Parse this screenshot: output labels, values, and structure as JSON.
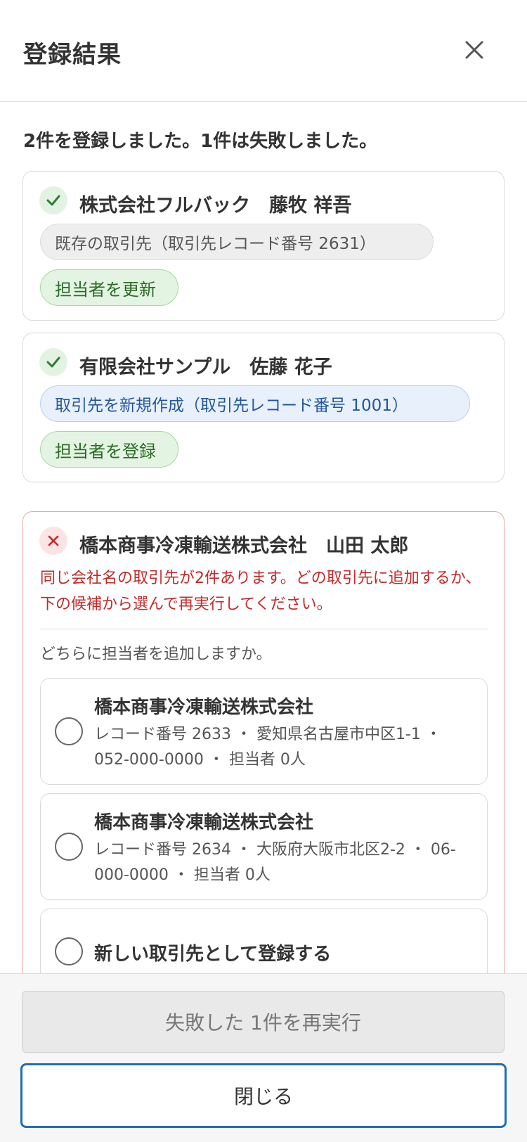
{
  "header": {
    "title": "登録結果",
    "close_icon": "close-icon"
  },
  "summary": "2件を登録しました。1件は失敗しました。",
  "results": [
    {
      "status": "success",
      "name": "株式会社フルバック　藤牧 祥吾",
      "account_badge": "既存の取引先（取引先レコード番号 2631）",
      "contact_badge": "担当者を更新"
    },
    {
      "status": "success",
      "name": "有限会社サンプル　佐藤 花子",
      "account_badge": "取引先を新規作成（取引先レコード番号 1001）",
      "contact_badge": "担当者を登録"
    },
    {
      "status": "failed",
      "name": "橋本商事冷凍輸送株式会社　山田 太郎",
      "error": "同じ会社名の取引先が2件あります。どの取引先に追加するか、下の候補から選んで再実行してください。",
      "question": "どちらに担当者を追加しますか。",
      "options": [
        {
          "title": "橋本商事冷凍輸送株式会社",
          "detail": "レコード番号 2633 ・ 愛知県名古屋市中区1-1 ・ 052-000-0000 ・ 担当者 0人"
        },
        {
          "title": "橋本商事冷凍輸送株式会社",
          "detail": "レコード番号 2634 ・ 大阪府大阪市北区2-2 ・ 06-000-0000 ・ 担当者 0人"
        },
        {
          "title": "新しい取引先として登録する"
        }
      ]
    }
  ],
  "footer": {
    "retry_label": "失敗した 1件を再実行",
    "close_label": "閉じる"
  },
  "colors": {
    "success": "#2e7d32",
    "error": "#c62828",
    "primary_border": "#1f6fb2"
  }
}
